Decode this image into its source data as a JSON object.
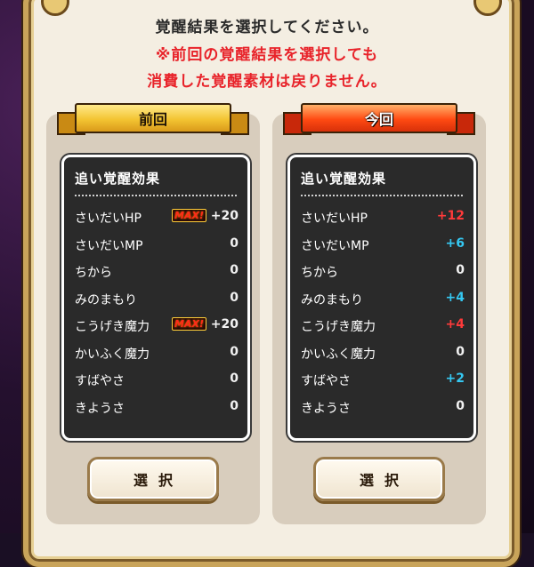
{
  "dialog": {
    "message_line1": "覚醒結果を選択してください。",
    "warning_line1": "※前回の覚醒結果を選択しても",
    "warning_line2": "消費した覚醒素材は戻りません。"
  },
  "panels": {
    "previous": {
      "ribbon": "前回",
      "table_title": "追い覚醒効果",
      "rows": [
        {
          "label": "さいだいHP",
          "value": "+20",
          "max": true,
          "color": "white"
        },
        {
          "label": "さいだいMP",
          "value": "0",
          "max": false,
          "color": "white"
        },
        {
          "label": "ちから",
          "value": "0",
          "max": false,
          "color": "white"
        },
        {
          "label": "みのまもり",
          "value": "0",
          "max": false,
          "color": "white"
        },
        {
          "label": "こうげき魔力",
          "value": "+20",
          "max": true,
          "color": "white"
        },
        {
          "label": "かいふく魔力",
          "value": "0",
          "max": false,
          "color": "white"
        },
        {
          "label": "すばやさ",
          "value": "0",
          "max": false,
          "color": "white"
        },
        {
          "label": "きようさ",
          "value": "0",
          "max": false,
          "color": "white"
        }
      ],
      "button": "選択"
    },
    "current": {
      "ribbon": "今回",
      "table_title": "追い覚醒効果",
      "rows": [
        {
          "label": "さいだいHP",
          "value": "+12",
          "color": "red"
        },
        {
          "label": "さいだいMP",
          "value": "+6",
          "color": "cyan"
        },
        {
          "label": "ちから",
          "value": "0",
          "color": "white"
        },
        {
          "label": "みのまもり",
          "value": "+4",
          "color": "cyan"
        },
        {
          "label": "こうげき魔力",
          "value": "+4",
          "color": "red"
        },
        {
          "label": "かいふく魔力",
          "value": "0",
          "color": "white"
        },
        {
          "label": "すばやさ",
          "value": "+2",
          "color": "cyan"
        },
        {
          "label": "きようさ",
          "value": "0",
          "color": "white"
        }
      ],
      "button": "選択"
    }
  },
  "max_badge_text": "MAX!",
  "colors": {
    "warning": "#e8232a",
    "increase_cyan": "#35c8f2",
    "decrease_red": "#ff3a3a",
    "gold_ribbon": "#f3c432",
    "red_ribbon": "#ff4a12"
  }
}
